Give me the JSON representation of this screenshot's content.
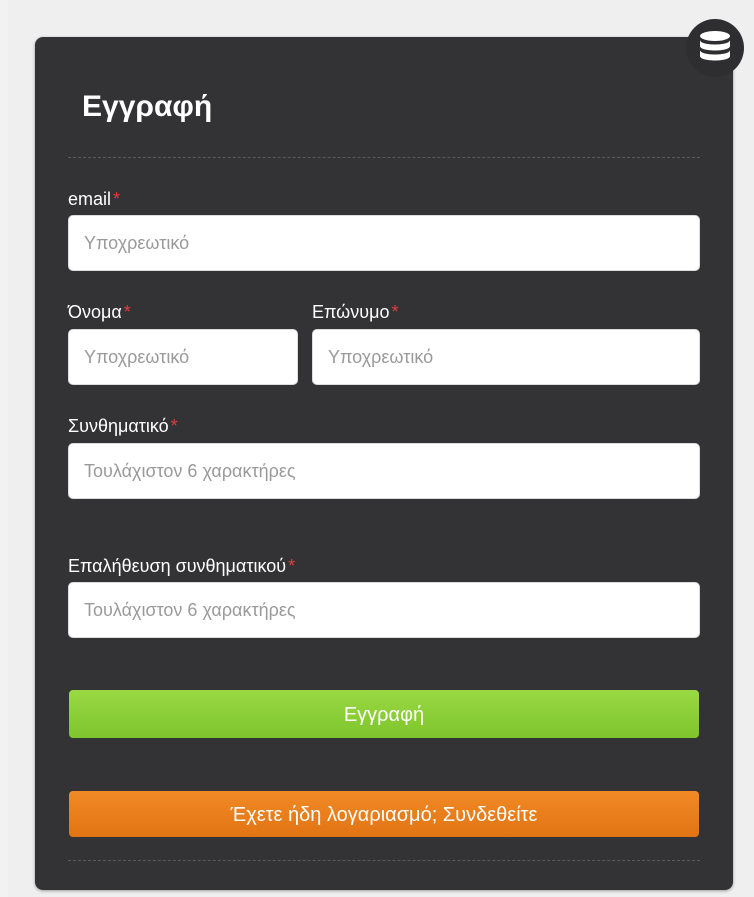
{
  "form": {
    "title": "Εγγραφή",
    "email_label": "email",
    "email_placeholder": "Υποχρεωτικό",
    "first_name_label": "Όνομα",
    "first_name_placeholder": "Υποχρεωτικό",
    "last_name_label": "Επώνυμο",
    "last_name_placeholder": "Υποχρεωτικό",
    "password_label": "Συνθηματικό",
    "password_placeholder": "Τουλάχιστον 6 χαρακτήρες",
    "confirm_label": "Επαλήθευση συνθηματικού",
    "confirm_placeholder": "Τουλάχιστον 6 χαρακτήρες",
    "required_marker": "*",
    "register_button": "Εγγραφή",
    "login_button": "Έχετε ήδη λογαριασμό; Συνδεθείτε"
  },
  "icons": {
    "badge": "database-icon"
  },
  "colors": {
    "panel": "#333336",
    "required": "#e23c3c",
    "register": "#8ccf36",
    "login": "#e8801b"
  }
}
